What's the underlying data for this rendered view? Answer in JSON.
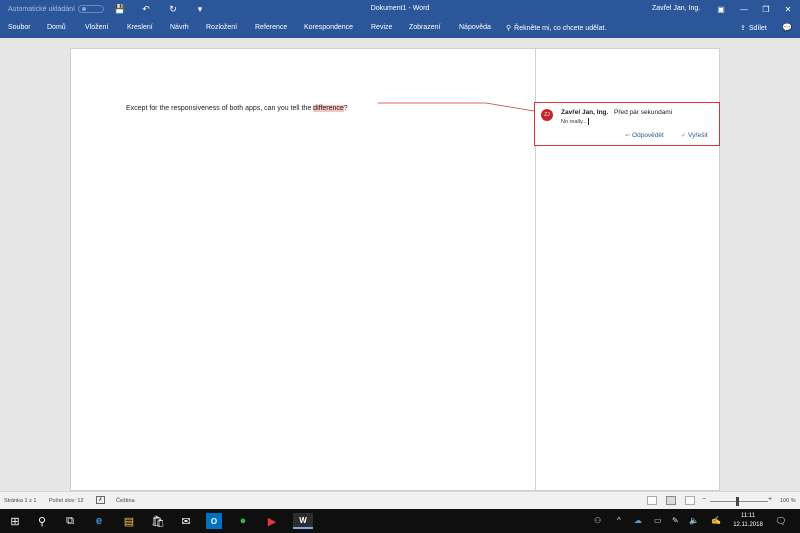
{
  "titlebar": {
    "autosave_label": "Automatické ukládání",
    "save_icon": "💾",
    "undo_icon": "↶",
    "redo_icon": "↻",
    "qat_more_icon": "▾",
    "doc_title": "Dokument1  -  Word",
    "user": "Zavřel Jan, Ing.",
    "ribbon_display_icon": "▣",
    "minimize": "—",
    "restore": "❐",
    "close": "✕"
  },
  "ribbon": {
    "tabs": [
      "Soubor",
      "Domů",
      "Vložení",
      "Kreslení",
      "Návrh",
      "Rozložení",
      "Reference",
      "Korespondence",
      "Revize",
      "Zobrazení",
      "Nápověda"
    ],
    "tellme": "Řekněte mi, co chcete udělat.",
    "share": "Sdílet",
    "search_icon": "⚲",
    "share_icon": "⇪",
    "comments_icon": "💬"
  },
  "document": {
    "text_before": "Except for the responsiveness of both apps, can you tell the ",
    "highlighted": "difference",
    "text_after": "?"
  },
  "comment": {
    "initials": "ZJ",
    "author": "Zavřel Jan, Ing.",
    "time": "Před pár sekundami",
    "text": "No really...",
    "reply": "Odpovědět",
    "resolve": "Vyřešit",
    "reply_icon": "↩",
    "resolve_icon": "✓"
  },
  "statusbar": {
    "page": "Stránka 1 z 1",
    "words": "Počet slov: 12",
    "proof_icon": "✗",
    "language": "Čeština",
    "zoom_minus": "−",
    "zoom_plus": "+",
    "zoom": "100 %"
  },
  "taskbar": {
    "start_icon": "⊞",
    "search_icon": "⚲",
    "taskview_icon": "⧉",
    "edge_icon": "e",
    "explorer_icon": "▤",
    "store_icon": "🛍",
    "mail_icon": "✉",
    "outlook_icon": "O",
    "app_green_icon": "●",
    "app_red_icon": "▶",
    "word_icon": "W",
    "tray_people": "⚇",
    "tray_chevron": "^",
    "tray_cloud": "☁",
    "tray_battery": "▭",
    "tray_pen": "✎",
    "tray_wifi": "◠",
    "tray_volume": "🔈",
    "tray_ink": "✍",
    "time": "11:11",
    "date": "12.11.2018",
    "notification_icon": "🗨"
  }
}
